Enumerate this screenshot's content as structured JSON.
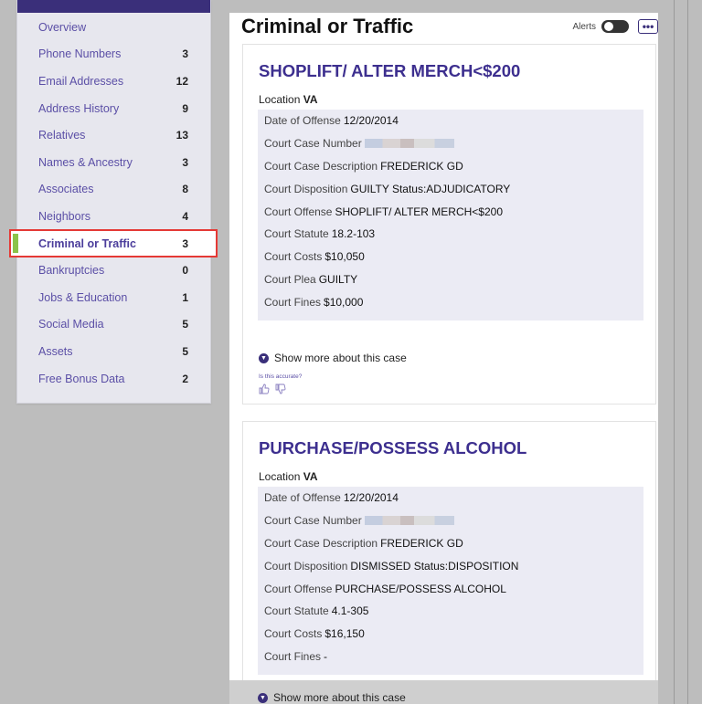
{
  "sidebar": {
    "items": [
      {
        "label": "Overview",
        "count": ""
      },
      {
        "label": "Phone Numbers",
        "count": "3"
      },
      {
        "label": "Email Addresses",
        "count": "12"
      },
      {
        "label": "Address History",
        "count": "9"
      },
      {
        "label": "Relatives",
        "count": "13"
      },
      {
        "label": "Names & Ancestry",
        "count": "3"
      },
      {
        "label": "Associates",
        "count": "8"
      },
      {
        "label": "Neighbors",
        "count": "4"
      },
      {
        "label": "Criminal or Traffic",
        "count": "3"
      },
      {
        "label": "Bankruptcies",
        "count": "0"
      },
      {
        "label": "Jobs & Education",
        "count": "1"
      },
      {
        "label": "Social Media",
        "count": "5"
      },
      {
        "label": "Assets",
        "count": "5"
      },
      {
        "label": "Free Bonus Data",
        "count": "2"
      }
    ],
    "active_index": 8
  },
  "main": {
    "title": "Criminal or Traffic",
    "alerts_label": "Alerts",
    "more_label": "•••"
  },
  "cases": [
    {
      "title": "SHOPLIFT/ ALTER MERCH<$200",
      "location_label": "Location",
      "location_value": "VA",
      "rows": [
        {
          "label": "Date of Offense",
          "value": "12/20/2014"
        },
        {
          "label": "Court Case Number",
          "value": ""
        },
        {
          "label": "Court Case Description",
          "value": "FREDERICK GD"
        },
        {
          "label": "Court Disposition",
          "value": "GUILTY Status:ADJUDICATORY"
        },
        {
          "label": "Court Offense",
          "value": "SHOPLIFT/ ALTER MERCH<$200"
        },
        {
          "label": "Court Statute",
          "value": "18.2-103"
        },
        {
          "label": "Court Costs",
          "value": "$10,050"
        },
        {
          "label": "Court Plea",
          "value": "GUILTY"
        },
        {
          "label": "Court Fines",
          "value": "$10,000"
        }
      ],
      "show_more": "Show more about this case",
      "accurate": "Is this accurate?"
    },
    {
      "title": "PURCHASE/POSSESS ALCOHOL",
      "location_label": "Location",
      "location_value": "VA",
      "rows": [
        {
          "label": "Date of Offense",
          "value": "12/20/2014"
        },
        {
          "label": "Court Case Number",
          "value": ""
        },
        {
          "label": "Court Case Description",
          "value": "FREDERICK GD"
        },
        {
          "label": "Court Disposition",
          "value": "DISMISSED Status:DISPOSITION"
        },
        {
          "label": "Court Offense",
          "value": "PURCHASE/POSSESS ALCOHOL"
        },
        {
          "label": "Court Statute",
          "value": "4.1-305"
        },
        {
          "label": "Court Costs",
          "value": "$16,150"
        },
        {
          "label": "Court Fines",
          "value": "-"
        }
      ],
      "show_more": "Show more about this case"
    }
  ],
  "colors": {
    "accent": "#3d2f8f",
    "active_bar": "#8bc34a",
    "highlight": "#e53935"
  },
  "icons": {
    "show_more": "chevron-down-circle-icon",
    "thumbs_up": "thumbs-up-icon",
    "thumbs_down": "thumbs-down-icon"
  }
}
